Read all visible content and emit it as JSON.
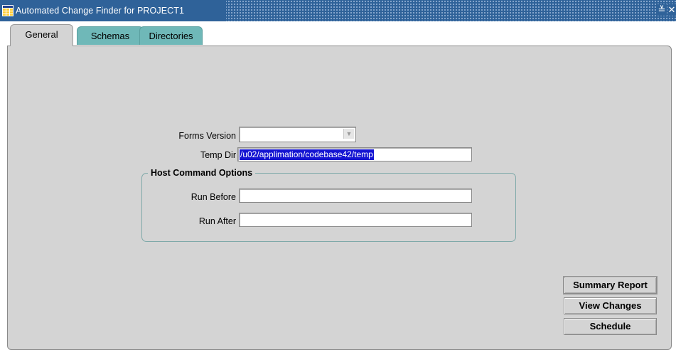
{
  "window": {
    "title": "Automated Change Finder for PROJECT1",
    "icon": "grid-window-icon",
    "controls": {
      "minimize_glyph": "≚",
      "close_glyph": "✕"
    }
  },
  "tabs": [
    {
      "label": "General",
      "active": true
    },
    {
      "label": "Schemas",
      "active": false
    },
    {
      "label": "Directories",
      "active": false
    }
  ],
  "form": {
    "forms_version": {
      "label": "Forms Version",
      "value": ""
    },
    "temp_dir": {
      "label": "Temp Dir",
      "value": "/u02/applimation/codebase42/temp"
    },
    "host_command_options": {
      "title": "Host Command Options",
      "run_before": {
        "label": "Run Before",
        "value": ""
      },
      "run_after": {
        "label": "Run After",
        "value": ""
      }
    }
  },
  "buttons": {
    "summary_report": "Summary Report",
    "view_changes": "View Changes",
    "schedule": "Schedule"
  },
  "colors": {
    "title_bar": "#2f6299",
    "panel": "#d4d4d4",
    "inactive_tab": "#6fb8b8",
    "selection": "#1414d2"
  }
}
